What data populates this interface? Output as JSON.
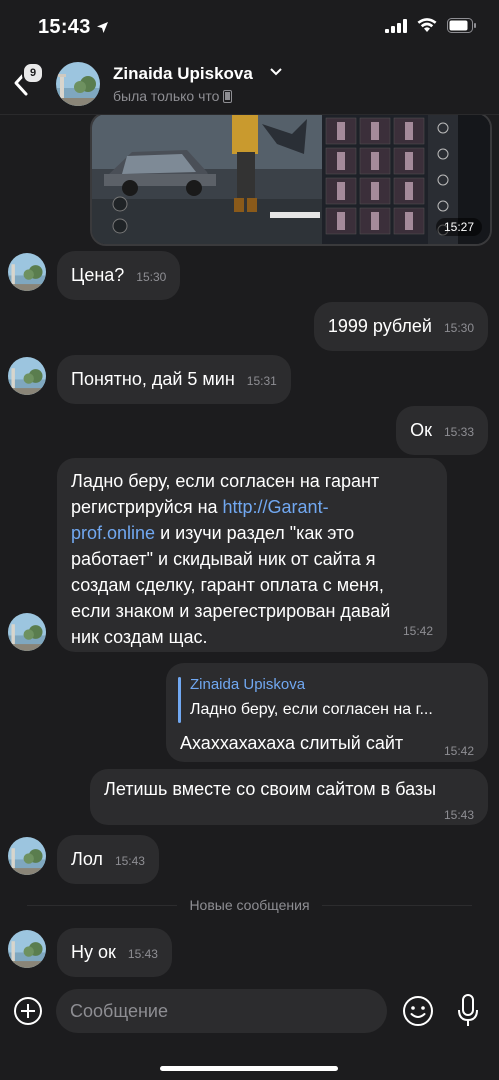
{
  "status_bar": {
    "time": "15:43"
  },
  "header": {
    "back_badge": "9",
    "name": "Zinaida Upiskova",
    "status": "была только что"
  },
  "image_message": {
    "time": "15:27"
  },
  "messages": [
    {
      "text": "Цена?",
      "time": "15:30"
    },
    {
      "text": "1999 рублей",
      "time": "15:30"
    },
    {
      "text": "Понятно, дай 5 мин",
      "time": "15:31"
    },
    {
      "text": "Ок",
      "time": "15:33"
    },
    {
      "line1": "Ладно беру, если согласен на гарант",
      "line2_pre": "регистрируйся на ",
      "link_part1": "http://Garant-",
      "link_part2": "prof.online",
      "line3_post": " и изучи раздел \"как это",
      "line4": "работает\" и скидывай ник от сайта я",
      "line5": "создам сделку, гарант оплата с меня,",
      "line6": "если знаком и зарегестрирован давай",
      "line7": "ник создам щас.",
      "time": "15:42"
    },
    {
      "reply_name": "Zinaida Upiskova",
      "reply_text": "Ладно беру, если согласен на г...",
      "text": "Ахаххахахаха слитый сайт",
      "time": "15:42"
    },
    {
      "text": "Летишь вместе со своим сайтом в базы",
      "time": "15:43"
    },
    {
      "text": "Лол",
      "time": "15:43"
    },
    {
      "text": "Ну ок",
      "time": "15:43"
    }
  ],
  "divider": "Новые сообщения",
  "composer": {
    "placeholder": "Сообщение"
  }
}
